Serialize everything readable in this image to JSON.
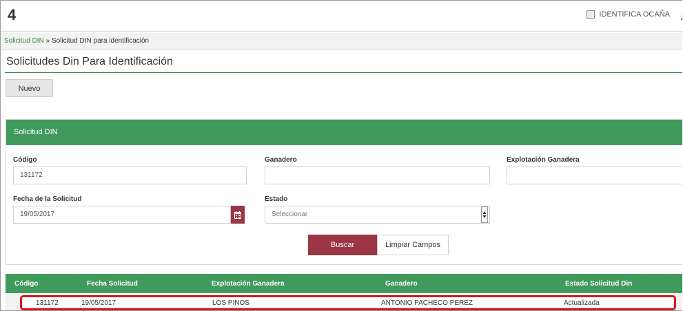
{
  "app": {
    "title": "4"
  },
  "user": {
    "name": "IDENTIFICA OCAÑA",
    "icon": "id-card-icon"
  },
  "breadcrumb": {
    "link": "Solicitud DIN",
    "separator": "»",
    "current": "Solicitud DIN para identificación"
  },
  "page": {
    "title": "Solicitudes Din Para Identificación"
  },
  "toolbar": {
    "nuevo_label": "Nuevo"
  },
  "panel": {
    "title": "Solicitud DIN",
    "fields": {
      "codigo": {
        "label": "Código",
        "value": "131172"
      },
      "ganadero": {
        "label": "Ganadero",
        "value": ""
      },
      "explotacion": {
        "label": "Explotación Ganadera",
        "value": ""
      },
      "fecha": {
        "label": "Fecha de la Solicitud",
        "value": "19/05/2017"
      },
      "estado": {
        "label": "Estado",
        "value": "Seleccionar"
      }
    },
    "buscar_label": "Buscar",
    "limpiar_label": "Limpiar Campos"
  },
  "table": {
    "columns": [
      "Código",
      "Fecha Solicitud",
      "Explotación Ganadera",
      "Ganadero",
      "Estado Solicitud Din"
    ],
    "rows": [
      [
        "131172",
        "19/05/2017",
        "LOS PINOS",
        "ANTONIO PACHECO PEREZ",
        "Actualizada"
      ]
    ]
  },
  "colors": {
    "accent_green": "#3f9a5c",
    "accent_maroon": "#9c3545",
    "highlight_red": "#e0141c"
  }
}
